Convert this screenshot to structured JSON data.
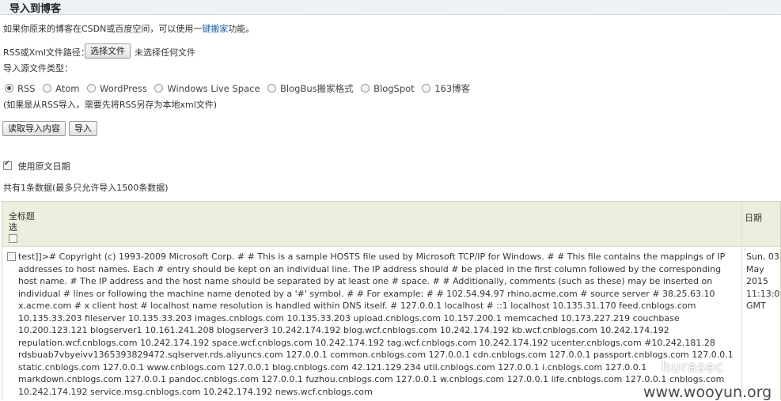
{
  "header": {
    "title": "导入到博客"
  },
  "intro": {
    "prefix": "如果你原来的博客在CSDN或百度空间，可以使用一",
    "link": "键搬家",
    "suffix": "功能。"
  },
  "file": {
    "label": "RSS或Xml文件路径：",
    "button": "选择文件",
    "status": "未选择任何文件"
  },
  "source_type": {
    "label": "导入源文件类型：",
    "options": [
      "RSS",
      "Atom",
      "WordPress",
      "Windows Live Space",
      "BlogBus搬家格式",
      "BlogSpot",
      "163博客"
    ],
    "selected": "RSS",
    "note": "(如果是从RSS导入，需要先将RSS另存为本地xml文件)"
  },
  "actions": {
    "read": "读取导入内容",
    "import": "导入"
  },
  "use_original_date": {
    "label": "使用原文日期",
    "checked": true
  },
  "summary": "共有1条数据(最多只允许导入1500条数据)",
  "table": {
    "header_title": "全标题",
    "header_select_all": "选",
    "header_date": "日期",
    "rows": [
      {
        "text": "test]]>#  Copyright (c) 1993-2009 Microsoft Corp. # # This is a sample HOSTS file used by Microsoft TCP/IP for Windows. # # This file contains the mappings of IP addresses to host names. Each # entry should be kept on an individual line. The IP address should # be placed in the first column followed by the corresponding host name. # The IP address and the host name should be separated by at least one # space. # # Additionally, comments (such as these) may be inserted on individual # lines or following the machine name denoted by a '#' symbol. # # For example: # # 102.54.94.97 rhino.acme.com # source server # 38.25.63.10 x.acme.com # x client host # localhost name resolution is handled within DNS itself. # 127.0.0.1 localhost # ::1 localhost 10.135.31.170 feed.cnblogs.com 10.135.33.203 fileserver 10.135.33.203 images.cnblogs.com 10.135.33.203 upload.cnblogs.com 10.157.200.1 memcached 10.173.227.219 couchbase 10.200.123.121 blogserver1 10.161.241.208 blogserver3 10.242.174.192 blog.wcf.cnblogs.com 10.242.174.192 kb.wcf.cnblogs.com 10.242.174.192 repulation.wcf.cnblogs.com 10.242.174.192 space.wcf.cnblogs.com 10.242.174.192 tag.wcf.cnblogs.com 10.242.174.192 ucenter.cnblogs.com #10.242.181.28 rdsbuab7vbyeivv1365393829472.sqlserver.rds.aliyuncs.com 127.0.0.1 common.cnblogs.com 127.0.0.1 cdn.cnblogs.com 127.0.0.1 passport.cnblogs.com 127.0.0.1 static.cnblogs.com 127.0.0.1 www.cnblogs.com 127.0.0.1 blog.cnblogs.com 42.121.129.234 util.cnblogs.com 127.0.0.1 i.cnblogs.com 127.0.0.1 markdown.cnblogs.com 127.0.0.1 pandoc.cnblogs.com 127.0.0.1 fuzhou.cnblogs.com 127.0.0.1 w.cnblogs.com 127.0.0.1 life.cnblogs.com 127.0.0.1 cnblogs.com 10.242.174.192 service.msg.cnblogs.com 10.242.174.192 news.wcf.cnblogs.com",
        "date": "Sun, 03 May 2015 11:13:00 GMT",
        "checked": false
      }
    ]
  },
  "watermarks": {
    "a": "hurasec",
    "b": "www.wooyun.org"
  }
}
